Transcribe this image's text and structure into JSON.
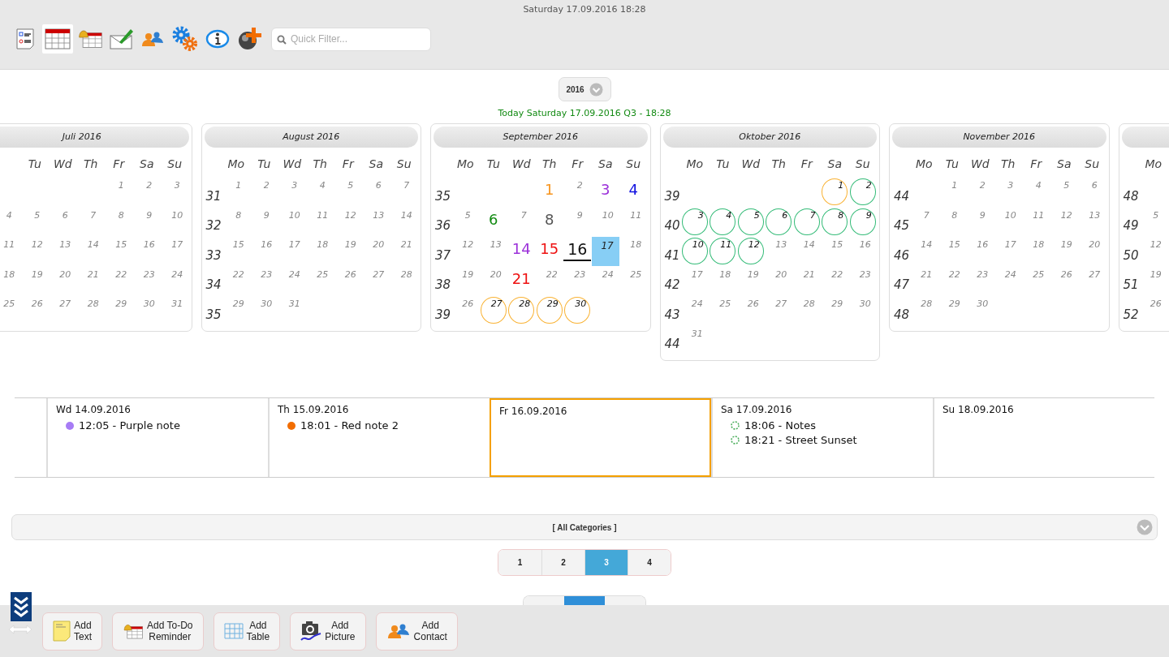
{
  "status_time": "Saturday 17.09.2016 18:28",
  "toolbar": [
    {
      "kind": "checklist",
      "selected": false
    },
    {
      "kind": "calendar",
      "selected": true
    },
    {
      "kind": "reminder",
      "selected": false
    },
    {
      "kind": "mail",
      "selected": false
    },
    {
      "kind": "contacts",
      "selected": false
    },
    {
      "kind": "settings",
      "selected": false
    },
    {
      "kind": "info",
      "selected": false
    },
    {
      "kind": "add",
      "selected": false
    }
  ],
  "search": {
    "placeholder": "Quick Filter..."
  },
  "year": "2016",
  "today": "Today Saturday 17.09.2016 Q3 - 18:28",
  "months": [
    {
      "title": "Juli 2016",
      "first_header_hidden": true,
      "headers": [
        "Tu",
        "Wd",
        "Th",
        "Fr",
        "Sa",
        "Su"
      ],
      "weeks": [
        {
          "days": [
            {
              "kind": "blank"
            },
            {
              "kind": "blank"
            },
            {
              "kind": "blank"
            },
            {
              "kind": "blank"
            },
            {
              "day": "1",
              "kind": "plain"
            },
            {
              "day": "2",
              "kind": "plain"
            },
            {
              "day": "3",
              "kind": "plain"
            }
          ]
        },
        {
          "days": [
            {
              "day": "4",
              "kind": "plain"
            },
            {
              "day": "5",
              "kind": "plain"
            },
            {
              "day": "6",
              "kind": "plain"
            },
            {
              "day": "7",
              "kind": "plain"
            },
            {
              "day": "8",
              "kind": "plain"
            },
            {
              "day": "9",
              "kind": "plain"
            },
            {
              "day": "10",
              "kind": "plain"
            }
          ]
        },
        {
          "days": [
            {
              "day": "11",
              "kind": "plain"
            },
            {
              "day": "12",
              "kind": "plain"
            },
            {
              "day": "13",
              "kind": "plain"
            },
            {
              "day": "14",
              "kind": "plain"
            },
            {
              "day": "15",
              "kind": "plain"
            },
            {
              "day": "16",
              "kind": "plain"
            },
            {
              "day": "17",
              "kind": "plain"
            }
          ]
        },
        {
          "days": [
            {
              "day": "18",
              "kind": "plain"
            },
            {
              "day": "19",
              "kind": "plain"
            },
            {
              "day": "20",
              "kind": "plain"
            },
            {
              "day": "21",
              "kind": "plain"
            },
            {
              "day": "22",
              "kind": "plain"
            },
            {
              "day": "23",
              "kind": "plain"
            },
            {
              "day": "24",
              "kind": "plain"
            }
          ]
        },
        {
          "days": [
            {
              "day": "25",
              "kind": "plain"
            },
            {
              "day": "26",
              "kind": "plain"
            },
            {
              "day": "27",
              "kind": "plain"
            },
            {
              "day": "28",
              "kind": "plain"
            },
            {
              "day": "29",
              "kind": "plain"
            },
            {
              "day": "30",
              "kind": "plain"
            },
            {
              "day": "31",
              "kind": "plain"
            }
          ]
        }
      ]
    },
    {
      "title": "August 2016",
      "headers": [
        "Mo",
        "Tu",
        "Wd",
        "Th",
        "Fr",
        "Sa",
        "Su"
      ],
      "weeks": [
        {
          "week": "31",
          "days": [
            {
              "day": "1",
              "kind": "plain"
            },
            {
              "day": "2",
              "kind": "plain"
            },
            {
              "day": "3",
              "kind": "plain"
            },
            {
              "day": "4",
              "kind": "plain"
            },
            {
              "day": "5",
              "kind": "plain"
            },
            {
              "day": "6",
              "kind": "plain"
            },
            {
              "day": "7",
              "kind": "plain"
            }
          ]
        },
        {
          "week": "32",
          "days": [
            {
              "day": "8",
              "kind": "plain"
            },
            {
              "day": "9",
              "kind": "plain"
            },
            {
              "day": "10",
              "kind": "plain"
            },
            {
              "day": "11",
              "kind": "plain"
            },
            {
              "day": "12",
              "kind": "plain"
            },
            {
              "day": "13",
              "kind": "plain"
            },
            {
              "day": "14",
              "kind": "plain"
            }
          ]
        },
        {
          "week": "33",
          "days": [
            {
              "day": "15",
              "kind": "plain"
            },
            {
              "day": "16",
              "kind": "plain"
            },
            {
              "day": "17",
              "kind": "plain"
            },
            {
              "day": "18",
              "kind": "plain"
            },
            {
              "day": "19",
              "kind": "plain"
            },
            {
              "day": "20",
              "kind": "plain"
            },
            {
              "day": "21",
              "kind": "plain"
            }
          ]
        },
        {
          "week": "34",
          "days": [
            {
              "day": "22",
              "kind": "plain"
            },
            {
              "day": "23",
              "kind": "plain"
            },
            {
              "day": "24",
              "kind": "plain"
            },
            {
              "day": "25",
              "kind": "plain"
            },
            {
              "day": "26",
              "kind": "plain"
            },
            {
              "day": "27",
              "kind": "plain"
            },
            {
              "day": "28",
              "kind": "plain"
            }
          ]
        },
        {
          "week": "35",
          "days": [
            {
              "day": "29",
              "kind": "plain"
            },
            {
              "day": "30",
              "kind": "plain"
            },
            {
              "day": "31",
              "kind": "plain"
            }
          ]
        }
      ]
    },
    {
      "title": "September 2016",
      "headers": [
        "Mo",
        "Tu",
        "Wd",
        "Th",
        "Fr",
        "Sa",
        "Su"
      ],
      "weeks": [
        {
          "week": "35",
          "days": [
            {
              "kind": "blank"
            },
            {
              "kind": "blank"
            },
            {
              "kind": "blank"
            },
            {
              "day": "1",
              "kind": "marked",
              "color": "#f7941d"
            },
            {
              "day": "2",
              "kind": "plain"
            },
            {
              "day": "3",
              "kind": "marked",
              "color": "#9b30d9"
            },
            {
              "day": "4",
              "kind": "marked",
              "color": "#1010e0"
            }
          ]
        },
        {
          "week": "36",
          "days": [
            {
              "day": "5",
              "kind": "plain"
            },
            {
              "day": "6",
              "kind": "marked",
              "color": "#118a11"
            },
            {
              "day": "7",
              "kind": "plain"
            },
            {
              "day": "8",
              "kind": "marked",
              "color": "#555555"
            },
            {
              "day": "9",
              "kind": "plain"
            },
            {
              "day": "10",
              "kind": "plain"
            },
            {
              "day": "11",
              "kind": "plain"
            }
          ]
        },
        {
          "week": "37",
          "days": [
            {
              "day": "12",
              "kind": "plain"
            },
            {
              "day": "13",
              "kind": "plain"
            },
            {
              "day": "14",
              "kind": "marked",
              "color": "#9b30d9"
            },
            {
              "day": "15",
              "kind": "marked",
              "color": "#ee1111"
            },
            {
              "day": "16",
              "kind": "current"
            },
            {
              "day": "17",
              "kind": "today"
            },
            {
              "day": "18",
              "kind": "plain"
            }
          ]
        },
        {
          "week": "38",
          "days": [
            {
              "day": "19",
              "kind": "plain"
            },
            {
              "day": "20",
              "kind": "plain"
            },
            {
              "day": "21",
              "kind": "marked",
              "color": "#ee1111"
            },
            {
              "day": "22",
              "kind": "plain"
            },
            {
              "day": "23",
              "kind": "plain"
            },
            {
              "day": "24",
              "kind": "plain"
            },
            {
              "day": "25",
              "kind": "plain"
            }
          ]
        },
        {
          "week": "39",
          "days": [
            {
              "day": "26",
              "kind": "plain"
            },
            {
              "day": "27",
              "kind": "ringed",
              "color": "#f9b233"
            },
            {
              "day": "28",
              "kind": "ringed",
              "color": "#f9b233"
            },
            {
              "day": "29",
              "kind": "ringed",
              "color": "#f9b233"
            },
            {
              "day": "30",
              "kind": "ringed",
              "color": "#f9b233"
            }
          ]
        }
      ]
    },
    {
      "title": "Oktober 2016",
      "headers": [
        "Mo",
        "Tu",
        "Wd",
        "Th",
        "Fr",
        "Sa",
        "Su"
      ],
      "weeks": [
        {
          "week": "39",
          "days": [
            {
              "kind": "blank"
            },
            {
              "kind": "blank"
            },
            {
              "kind": "blank"
            },
            {
              "kind": "blank"
            },
            {
              "kind": "blank"
            },
            {
              "day": "1",
              "kind": "ringed",
              "color": "#f9b233"
            },
            {
              "day": "2",
              "kind": "ringed",
              "color": "#33bb77"
            }
          ]
        },
        {
          "week": "40",
          "days": [
            {
              "day": "3",
              "kind": "ringed",
              "color": "#33bb77"
            },
            {
              "day": "4",
              "kind": "ringed",
              "color": "#33bb77"
            },
            {
              "day": "5",
              "kind": "ringed",
              "color": "#33bb77"
            },
            {
              "day": "6",
              "kind": "ringed",
              "color": "#33bb77"
            },
            {
              "day": "7",
              "kind": "ringed",
              "color": "#33bb77"
            },
            {
              "day": "8",
              "kind": "ringed",
              "color": "#33bb77"
            },
            {
              "day": "9",
              "kind": "ringed",
              "color": "#33bb77"
            }
          ]
        },
        {
          "week": "41",
          "days": [
            {
              "day": "10",
              "kind": "ringed",
              "color": "#33bb77"
            },
            {
              "day": "11",
              "kind": "ringed",
              "color": "#33bb77"
            },
            {
              "day": "12",
              "kind": "ringed",
              "color": "#33bb77"
            },
            {
              "day": "13",
              "kind": "plain"
            },
            {
              "day": "14",
              "kind": "plain"
            },
            {
              "day": "15",
              "kind": "plain"
            },
            {
              "day": "16",
              "kind": "plain"
            }
          ]
        },
        {
          "week": "42",
          "days": [
            {
              "day": "17",
              "kind": "plain"
            },
            {
              "day": "18",
              "kind": "plain"
            },
            {
              "day": "19",
              "kind": "plain"
            },
            {
              "day": "20",
              "kind": "plain"
            },
            {
              "day": "21",
              "kind": "plain"
            },
            {
              "day": "22",
              "kind": "plain"
            },
            {
              "day": "23",
              "kind": "plain"
            }
          ]
        },
        {
          "week": "43",
          "days": [
            {
              "day": "24",
              "kind": "plain"
            },
            {
              "day": "25",
              "kind": "plain"
            },
            {
              "day": "26",
              "kind": "plain"
            },
            {
              "day": "27",
              "kind": "plain"
            },
            {
              "day": "28",
              "kind": "plain"
            },
            {
              "day": "29",
              "kind": "plain"
            },
            {
              "day": "30",
              "kind": "plain"
            }
          ]
        },
        {
          "week": "44",
          "days": [
            {
              "day": "31",
              "kind": "plain"
            }
          ]
        }
      ]
    },
    {
      "title": "November 2016",
      "headers": [
        "Mo",
        "Tu",
        "Wd",
        "Th",
        "Fr",
        "Sa",
        "Su"
      ],
      "weeks": [
        {
          "week": "44",
          "days": [
            {
              "kind": "blank"
            },
            {
              "day": "1",
              "kind": "plain"
            },
            {
              "day": "2",
              "kind": "plain"
            },
            {
              "day": "3",
              "kind": "plain"
            },
            {
              "day": "4",
              "kind": "plain"
            },
            {
              "day": "5",
              "kind": "plain"
            },
            {
              "day": "6",
              "kind": "plain"
            }
          ]
        },
        {
          "week": "45",
          "days": [
            {
              "day": "7",
              "kind": "plain"
            },
            {
              "day": "8",
              "kind": "plain"
            },
            {
              "day": "9",
              "kind": "plain"
            },
            {
              "day": "10",
              "kind": "plain"
            },
            {
              "day": "11",
              "kind": "plain"
            },
            {
              "day": "12",
              "kind": "plain"
            },
            {
              "day": "13",
              "kind": "plain"
            }
          ]
        },
        {
          "week": "46",
          "days": [
            {
              "day": "14",
              "kind": "plain"
            },
            {
              "day": "15",
              "kind": "plain"
            },
            {
              "day": "16",
              "kind": "plain"
            },
            {
              "day": "17",
              "kind": "plain"
            },
            {
              "day": "18",
              "kind": "plain"
            },
            {
              "day": "19",
              "kind": "plain"
            },
            {
              "day": "20",
              "kind": "plain"
            }
          ]
        },
        {
          "week": "47",
          "days": [
            {
              "day": "21",
              "kind": "plain"
            },
            {
              "day": "22",
              "kind": "plain"
            },
            {
              "day": "23",
              "kind": "plain"
            },
            {
              "day": "24",
              "kind": "plain"
            },
            {
              "day": "25",
              "kind": "plain"
            },
            {
              "day": "26",
              "kind": "plain"
            },
            {
              "day": "27",
              "kind": "plain"
            }
          ]
        },
        {
          "week": "48",
          "days": [
            {
              "day": "28",
              "kind": "plain"
            },
            {
              "day": "29",
              "kind": "plain"
            },
            {
              "day": "30",
              "kind": "plain"
            }
          ]
        }
      ]
    },
    {
      "headers": [
        "Mo"
      ],
      "weeks": [
        {
          "week": "48",
          "days": [
            {
              "kind": "blank"
            }
          ]
        },
        {
          "week": "49",
          "days": [
            {
              "day": "5",
              "kind": "plain"
            }
          ]
        },
        {
          "week": "50",
          "days": [
            {
              "day": "12",
              "kind": "plain"
            }
          ]
        },
        {
          "week": "51",
          "days": [
            {
              "day": "19",
              "kind": "plain"
            }
          ]
        },
        {
          "week": "52",
          "days": [
            {
              "day": "26",
              "kind": "plain"
            }
          ]
        }
      ]
    }
  ],
  "week_days": [
    {
      "date": "Wd 14.09.2016",
      "selected": false,
      "entries": [
        {
          "text": "12:05 - Purple note",
          "kind": "filled",
          "color": "#a77cf5"
        }
      ]
    },
    {
      "date": "Th 15.09.2016",
      "selected": false,
      "entries": [
        {
          "text": "18:01 - Red note 2",
          "kind": "filled",
          "color": "#f26d00"
        }
      ]
    },
    {
      "date": "Fr 16.09.2016",
      "selected": true
    },
    {
      "date": "Sa 17.09.2016",
      "selected": false,
      "entries": [
        {
          "text": "18:06 - Notes",
          "kind": "outline",
          "color": "#44aa55"
        },
        {
          "text": "18:21 - Street Sunset",
          "kind": "outline",
          "color": "#44aa55"
        }
      ]
    },
    {
      "date": "Su 18.09.2016",
      "selected": false
    }
  ],
  "category_filter": "[ All Categories ]",
  "pages": [
    {
      "label": "1",
      "selected": false
    },
    {
      "label": "2",
      "selected": false
    },
    {
      "label": "3",
      "selected": true
    },
    {
      "label": "4",
      "selected": false
    }
  ],
  "view_switch": [
    {
      "selected": false
    },
    {
      "selected": true
    },
    {
      "selected": false
    }
  ],
  "actions": [
    {
      "kind": "text",
      "lines": [
        "Add",
        "Text"
      ]
    },
    {
      "kind": "todo",
      "lines": [
        "Add To-Do",
        "Reminder"
      ]
    },
    {
      "kind": "table",
      "lines": [
        "Add",
        "Table"
      ]
    },
    {
      "kind": "picture",
      "lines": [
        "Add",
        "Picture"
      ]
    },
    {
      "kind": "contact",
      "lines": [
        "Add",
        "Contact"
      ]
    }
  ]
}
